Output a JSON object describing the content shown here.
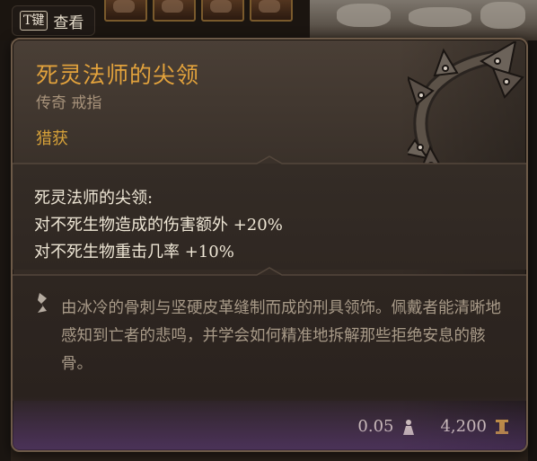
{
  "hint": {
    "key": "T键",
    "label": "查看"
  },
  "item": {
    "name": "死灵法师的尖领",
    "type": "传奇 戒指",
    "tag": "猎获",
    "icon": "spiked-collar-icon"
  },
  "properties": {
    "heading": "死灵法师的尖领:",
    "lines": [
      "对不死生物造成的伤害额外 +20%",
      "对不死生物重击几率 +10%"
    ]
  },
  "description": {
    "icon": "quote-icon",
    "text": "由冰冷的骨刺与坚硬皮革缝制而成的刑具领饰。佩戴者能清晰地感知到亡者的悲鸣，并学会如何精准地拆解那些拒绝安息的骸骨。"
  },
  "footer": {
    "weight": "0.05",
    "weight_icon": "weight-icon",
    "value": "4,200",
    "value_icon": "gold-icon"
  },
  "colors": {
    "title": "#e2a23c",
    "tag": "#d6a139",
    "panel": "#3a312a",
    "border": "#6d5a48"
  }
}
